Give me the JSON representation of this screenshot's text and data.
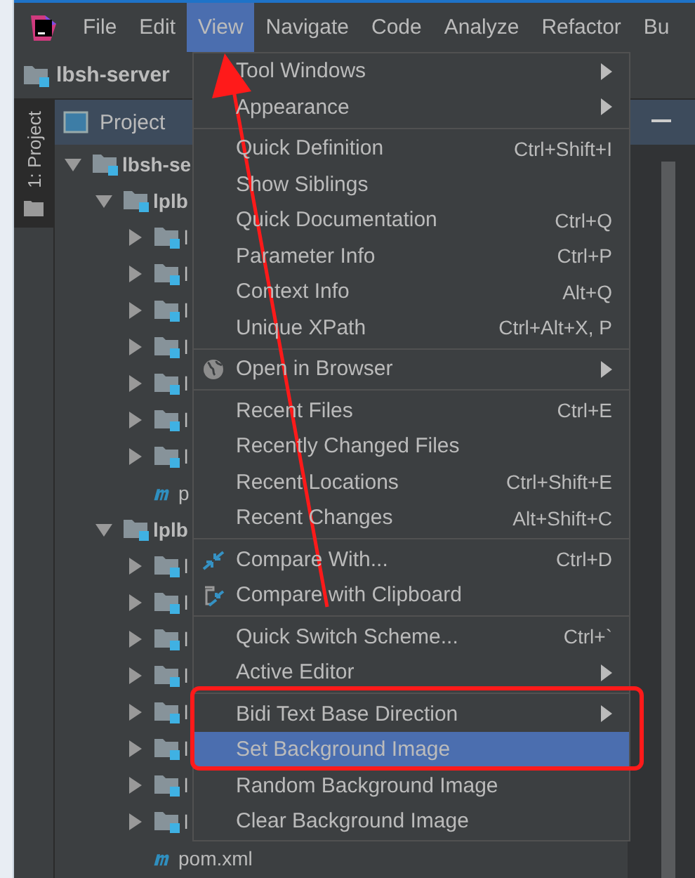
{
  "menu_bar": [
    {
      "label": "File",
      "selected": false
    },
    {
      "label": "Edit",
      "selected": false
    },
    {
      "label": "View",
      "selected": true
    },
    {
      "label": "Navigate",
      "selected": false
    },
    {
      "label": "Code",
      "selected": false
    },
    {
      "label": "Analyze",
      "selected": false
    },
    {
      "label": "Refactor",
      "selected": false
    },
    {
      "label": "Bu",
      "selected": false
    }
  ],
  "breadcrumb": "lbsh-server",
  "tool_stripe": "1: Project",
  "project_panel": {
    "title": "Project",
    "tree": [
      {
        "label": "lbsh-se",
        "kind": "folder",
        "expanded": true,
        "children": [
          {
            "label": "lplb",
            "kind": "folder",
            "expanded": true,
            "children": [
              {
                "label": "l",
                "kind": "folder",
                "expanded": false
              },
              {
                "label": "l",
                "kind": "folder",
                "expanded": false
              },
              {
                "label": "l",
                "kind": "folder",
                "expanded": false
              },
              {
                "label": "l",
                "kind": "folder",
                "expanded": false
              },
              {
                "label": "l",
                "kind": "folder",
                "expanded": false
              },
              {
                "label": "l",
                "kind": "folder",
                "expanded": false
              },
              {
                "label": "l",
                "kind": "folder",
                "expanded": false
              },
              {
                "label": "p",
                "kind": "maven"
              }
            ]
          },
          {
            "label": "lplb",
            "kind": "folder",
            "expanded": true,
            "children": [
              {
                "label": "l",
                "kind": "folder",
                "expanded": false
              },
              {
                "label": "l",
                "kind": "folder",
                "expanded": false
              },
              {
                "label": "l",
                "kind": "folder",
                "expanded": false
              },
              {
                "label": "l",
                "kind": "folder",
                "expanded": false
              },
              {
                "label": "l",
                "kind": "folder",
                "expanded": false
              },
              {
                "label": "l",
                "kind": "folder",
                "expanded": false
              },
              {
                "label": "l",
                "kind": "folder",
                "expanded": false
              },
              {
                "label": "l",
                "kind": "folder",
                "expanded": false
              },
              {
                "label": "pom.xml",
                "kind": "maven"
              }
            ]
          }
        ]
      }
    ]
  },
  "view_menu": [
    {
      "label": "Tool Windows",
      "kind": "plain",
      "submenu": true,
      "selected": false
    },
    {
      "label": "Appearance",
      "kind": "plain",
      "submenu": true,
      "selected": false
    },
    {
      "label": "Quick Definition",
      "kind": "plain",
      "shortcut": "Ctrl+Shift+I",
      "separator_before": true,
      "selected": false
    },
    {
      "label": "Show Siblings",
      "kind": "plain",
      "selected": false
    },
    {
      "label": "Quick Documentation",
      "kind": "plain",
      "shortcut": "Ctrl+Q",
      "selected": false
    },
    {
      "label": "Parameter Info",
      "kind": "plain",
      "shortcut": "Ctrl+P",
      "selected": false
    },
    {
      "label": "Context Info",
      "kind": "plain",
      "shortcut": "Alt+Q",
      "selected": false
    },
    {
      "label": "Unique XPath",
      "kind": "plain",
      "shortcut": "Ctrl+Alt+X, P",
      "selected": false
    },
    {
      "label": "Open in Browser",
      "kind": "browser",
      "submenu": true,
      "separator_before": true,
      "selected": false
    },
    {
      "label": "Recent Files",
      "kind": "plain",
      "shortcut": "Ctrl+E",
      "separator_before": true,
      "selected": false
    },
    {
      "label": "Recently Changed Files",
      "kind": "plain",
      "selected": false
    },
    {
      "label": "Recent Locations",
      "kind": "plain",
      "shortcut": "Ctrl+Shift+E",
      "selected": false
    },
    {
      "label": "Recent Changes",
      "kind": "plain",
      "shortcut": "Alt+Shift+C",
      "selected": false
    },
    {
      "label": "Compare With...",
      "kind": "diff",
      "shortcut": "Ctrl+D",
      "separator_before": true,
      "selected": false
    },
    {
      "label": "Compare with Clipboard",
      "kind": "clipdiff",
      "selected": false
    },
    {
      "label": "Quick Switch Scheme...",
      "kind": "plain",
      "shortcut": "Ctrl+`",
      "separator_before": true,
      "selected": false
    },
    {
      "label": "Active Editor",
      "kind": "plain",
      "submenu": true,
      "selected": false
    },
    {
      "label": "Bidi Text Base Direction",
      "kind": "plain",
      "submenu": true,
      "separator_before": true,
      "selected": false
    },
    {
      "label": "Set Background Image",
      "kind": "plain",
      "selected": true
    },
    {
      "label": "Random Background Image",
      "kind": "plain",
      "selected": false
    },
    {
      "label": "Clear Background Image",
      "kind": "plain",
      "selected": false
    }
  ]
}
